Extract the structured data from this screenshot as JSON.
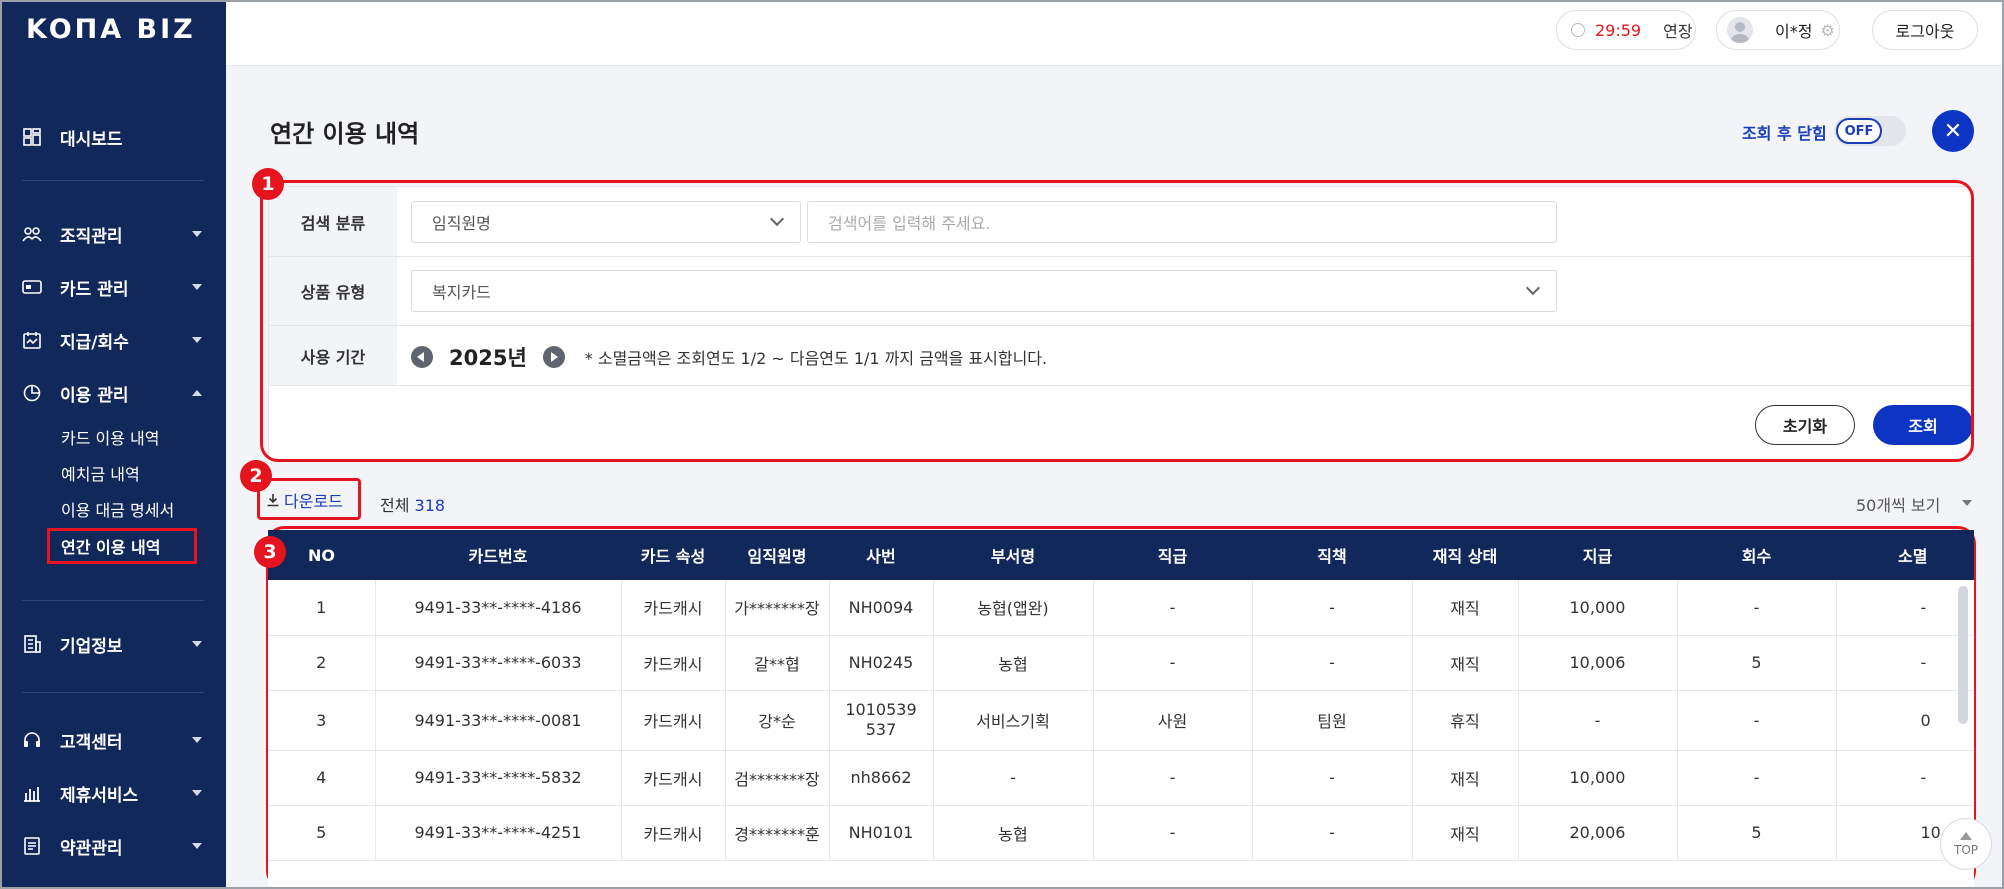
{
  "brand": {
    "logo": "KOΠA BIZ"
  },
  "sidebar": {
    "items": [
      {
        "label": "대시보드",
        "icon": "dashboard-icon"
      },
      {
        "label": "조직관리",
        "icon": "org-icon"
      },
      {
        "label": "카드 관리",
        "icon": "card-icon"
      },
      {
        "label": "지급/회수",
        "icon": "payment-icon"
      },
      {
        "label": "이용 관리",
        "icon": "pie-icon"
      },
      {
        "label": "기업정보",
        "icon": "building-icon"
      },
      {
        "label": "고객센터",
        "icon": "headset-icon"
      },
      {
        "label": "제휴서비스",
        "icon": "partner-icon"
      },
      {
        "label": "약관관리",
        "icon": "document-icon"
      }
    ],
    "subitems": [
      "카드 이용 내역",
      "예치금 내역",
      "이용 대금 명세서",
      "연간 이용 내역"
    ]
  },
  "header": {
    "timer": "29:59",
    "extend": "연장",
    "user": "이*정",
    "logout": "로그아웃"
  },
  "page": {
    "title": "연간 이용 내역",
    "close_after_label": "조회 후 닫힘",
    "toggle": "OFF"
  },
  "search": {
    "category_label": "검색 분류",
    "category_value": "임직원명",
    "keyword_placeholder": "검색어를 입력해 주세요.",
    "product_label": "상품 유형",
    "product_value": "복지카드",
    "period_label": "사용 기간",
    "year": "2025년",
    "note": "* 소멸금액은 조회연도 1/2 ~ 다음연도 1/1 까지 금액을 표시합니다.",
    "reset": "초기화",
    "submit": "조회"
  },
  "annotations": [
    "1",
    "2",
    "3"
  ],
  "toolbar": {
    "download": "다운로드",
    "total_label": "전체",
    "total_count": "318",
    "per_page": "50개씩 보기"
  },
  "table": {
    "headers": [
      "NO",
      "카드번호",
      "카드 속성",
      "임직원명",
      "사번",
      "부서명",
      "직급",
      "직책",
      "재직 상태",
      "지급",
      "회수",
      "소멸"
    ],
    "rows": [
      [
        "1",
        "9491-33**-****-4186",
        "카드캐시",
        "가*******장",
        "NH0094",
        "농협(앱완)",
        "-",
        "-",
        "재직",
        "10,000",
        "-",
        "-"
      ],
      [
        "2",
        "9491-33**-****-6033",
        "카드캐시",
        "갈**협",
        "NH0245",
        "농협",
        "-",
        "-",
        "재직",
        "10,006",
        "5",
        "-"
      ],
      [
        "3",
        "9491-33**-****-0081",
        "카드캐시",
        "강*순",
        "1010539 537",
        "서비스기획",
        "사원",
        "팀원",
        "휴직",
        "-",
        "-",
        "0"
      ],
      [
        "4",
        "9491-33**-****-5832",
        "카드캐시",
        "검*******장",
        "nh8662",
        "-",
        "-",
        "-",
        "재직",
        "10,000",
        "-",
        "-"
      ],
      [
        "5",
        "9491-33**-****-4251",
        "카드캐시",
        "경*******훈",
        "NH0101",
        "농협",
        "-",
        "-",
        "재직",
        "20,006",
        "5",
        "10"
      ]
    ]
  },
  "top_button": "TOP",
  "colors": {
    "navy": "#13285a",
    "primary": "#0c35c4",
    "annotation": "#e6141e",
    "timer": "#e6141e"
  }
}
